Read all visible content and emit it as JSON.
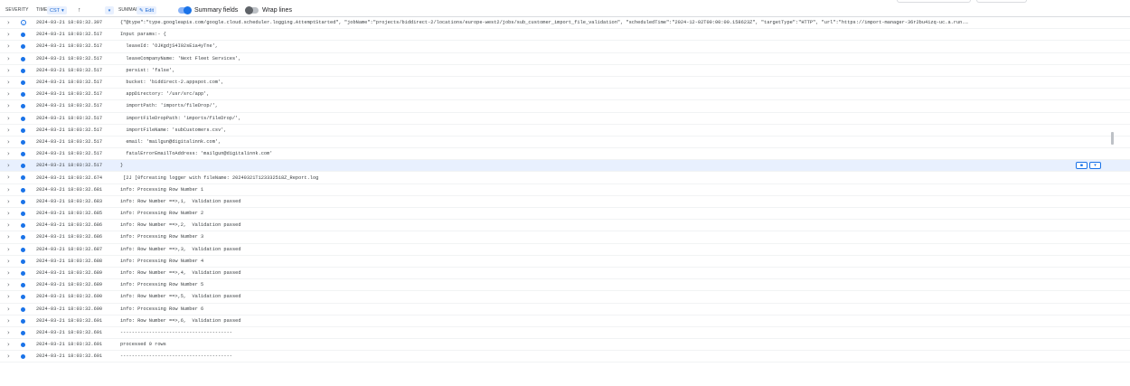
{
  "header": {
    "severity_label": "SEVERITY",
    "time_label": "TIME",
    "timezone": "CST",
    "sort_icon": "arrow-up-icon",
    "summary_label": "SUMMARY",
    "edit_label": "Edit",
    "summary_fields_label": "Summary fields",
    "summary_fields_on": true,
    "wrap_lines_label": "Wrap lines",
    "wrap_lines_on": false
  },
  "colors": {
    "accent": "#1a73e8",
    "highlight": "#e8f0fe"
  },
  "rows": [
    {
      "ts": "2024-03-21 18:03:32.397",
      "summary": "{\"@type\":\"type.googleapis.com/google.cloud.scheduler.logging.AttemptStarted\", \"jobName\":\"projects/biddirect-2/locations/europe-west2/jobs/sub_customer_import_file_validation\", \"scheduledTime\":\"2024-12-02T00:00:00.158623Z\", \"targetType\":\"HTTP\", \"url\":\"https://import-manager-36r2bu4izq-uc.a.run.…",
      "severity": "info"
    },
    {
      "ts": "2024-03-21 18:03:32.517",
      "summary": "Input params:- {",
      "severity": "default"
    },
    {
      "ts": "2024-03-21 18:03:32.517",
      "summary": "  leaseId: 'OJKgdjS4I02sEia4yTne',",
      "severity": "default"
    },
    {
      "ts": "2024-03-21 18:03:32.517",
      "summary": "  leaseCompanyName: 'Next Fleet Services',",
      "severity": "default"
    },
    {
      "ts": "2024-03-21 18:03:32.517",
      "summary": "  persist: 'false',",
      "severity": "default"
    },
    {
      "ts": "2024-03-21 18:03:32.517",
      "summary": "  bucket: 'biddirect-2.appspot.com',",
      "severity": "default"
    },
    {
      "ts": "2024-03-21 18:03:32.517",
      "summary": "  appDirectory: '/usr/src/app',",
      "severity": "default"
    },
    {
      "ts": "2024-03-21 18:03:32.517",
      "summary": "  importPath: 'imports/fileDrop/',",
      "severity": "default"
    },
    {
      "ts": "2024-03-21 18:03:32.517",
      "summary": "  importFileDropPath: 'imports/fileDrop/',",
      "severity": "default"
    },
    {
      "ts": "2024-03-21 18:03:32.517",
      "summary": "  importFileName: 'subCustomers.csv',",
      "severity": "default"
    },
    {
      "ts": "2024-03-21 18:03:32.517",
      "summary": "  email: 'mailgun@digitalinnk.com',",
      "severity": "default"
    },
    {
      "ts": "2024-03-21 18:03:32.517",
      "summary": "  fatalErrorEmailToAddress: 'mailgun@digitalinnk.com'",
      "severity": "default"
    },
    {
      "ts": "2024-03-21 18:03:32.517",
      "summary": "}",
      "severity": "default",
      "highlight": true
    },
    {
      "ts": "2024-03-21 18:03:32.674",
      "summary": " [2J [0fcreating logger with fileName: 20240321T123332518Z_Report.log",
      "severity": "default"
    },
    {
      "ts": "2024-03-21 18:03:32.681",
      "summary": "info: Processing Row Number 1",
      "severity": "default"
    },
    {
      "ts": "2024-03-21 18:03:32.683",
      "summary": "info: Row Number ==>,1,  Validation passed",
      "severity": "default"
    },
    {
      "ts": "2024-03-21 18:03:32.685",
      "summary": "info: Processing Row Number 2",
      "severity": "default"
    },
    {
      "ts": "2024-03-21 18:03:32.686",
      "summary": "info: Row Number ==>,2,  Validation passed",
      "severity": "default"
    },
    {
      "ts": "2024-03-21 18:03:32.686",
      "summary": "info: Processing Row Number 3",
      "severity": "default"
    },
    {
      "ts": "2024-03-21 18:03:32.687",
      "summary": "info: Row Number ==>,3,  Validation passed",
      "severity": "default"
    },
    {
      "ts": "2024-03-21 18:03:32.688",
      "summary": "info: Processing Row Number 4",
      "severity": "default"
    },
    {
      "ts": "2024-03-21 18:03:32.689",
      "summary": "info: Row Number ==>,4,  Validation passed",
      "severity": "default"
    },
    {
      "ts": "2024-03-21 18:03:32.689",
      "summary": "info: Processing Row Number 5",
      "severity": "default"
    },
    {
      "ts": "2024-03-21 18:03:32.690",
      "summary": "info: Row Number ==>,5,  Validation passed",
      "severity": "default"
    },
    {
      "ts": "2024-03-21 18:03:32.690",
      "summary": "info: Processing Row Number 6",
      "severity": "default"
    },
    {
      "ts": "2024-03-21 18:03:32.691",
      "summary": "info: Row Number ==>,6,  Validation passed",
      "severity": "default"
    },
    {
      "ts": "2024-03-21 18:03:32.691",
      "summary": "---------------------------------------",
      "severity": "default"
    },
    {
      "ts": "2024-03-21 18:03:32.691",
      "summary": "processed 0 rows",
      "severity": "default"
    },
    {
      "ts": "2024-03-21 18:03:32.691",
      "summary": "---------------------------------------",
      "severity": "default"
    }
  ],
  "row_action_icons": [
    "pin-icon",
    "more-actions-icon"
  ]
}
